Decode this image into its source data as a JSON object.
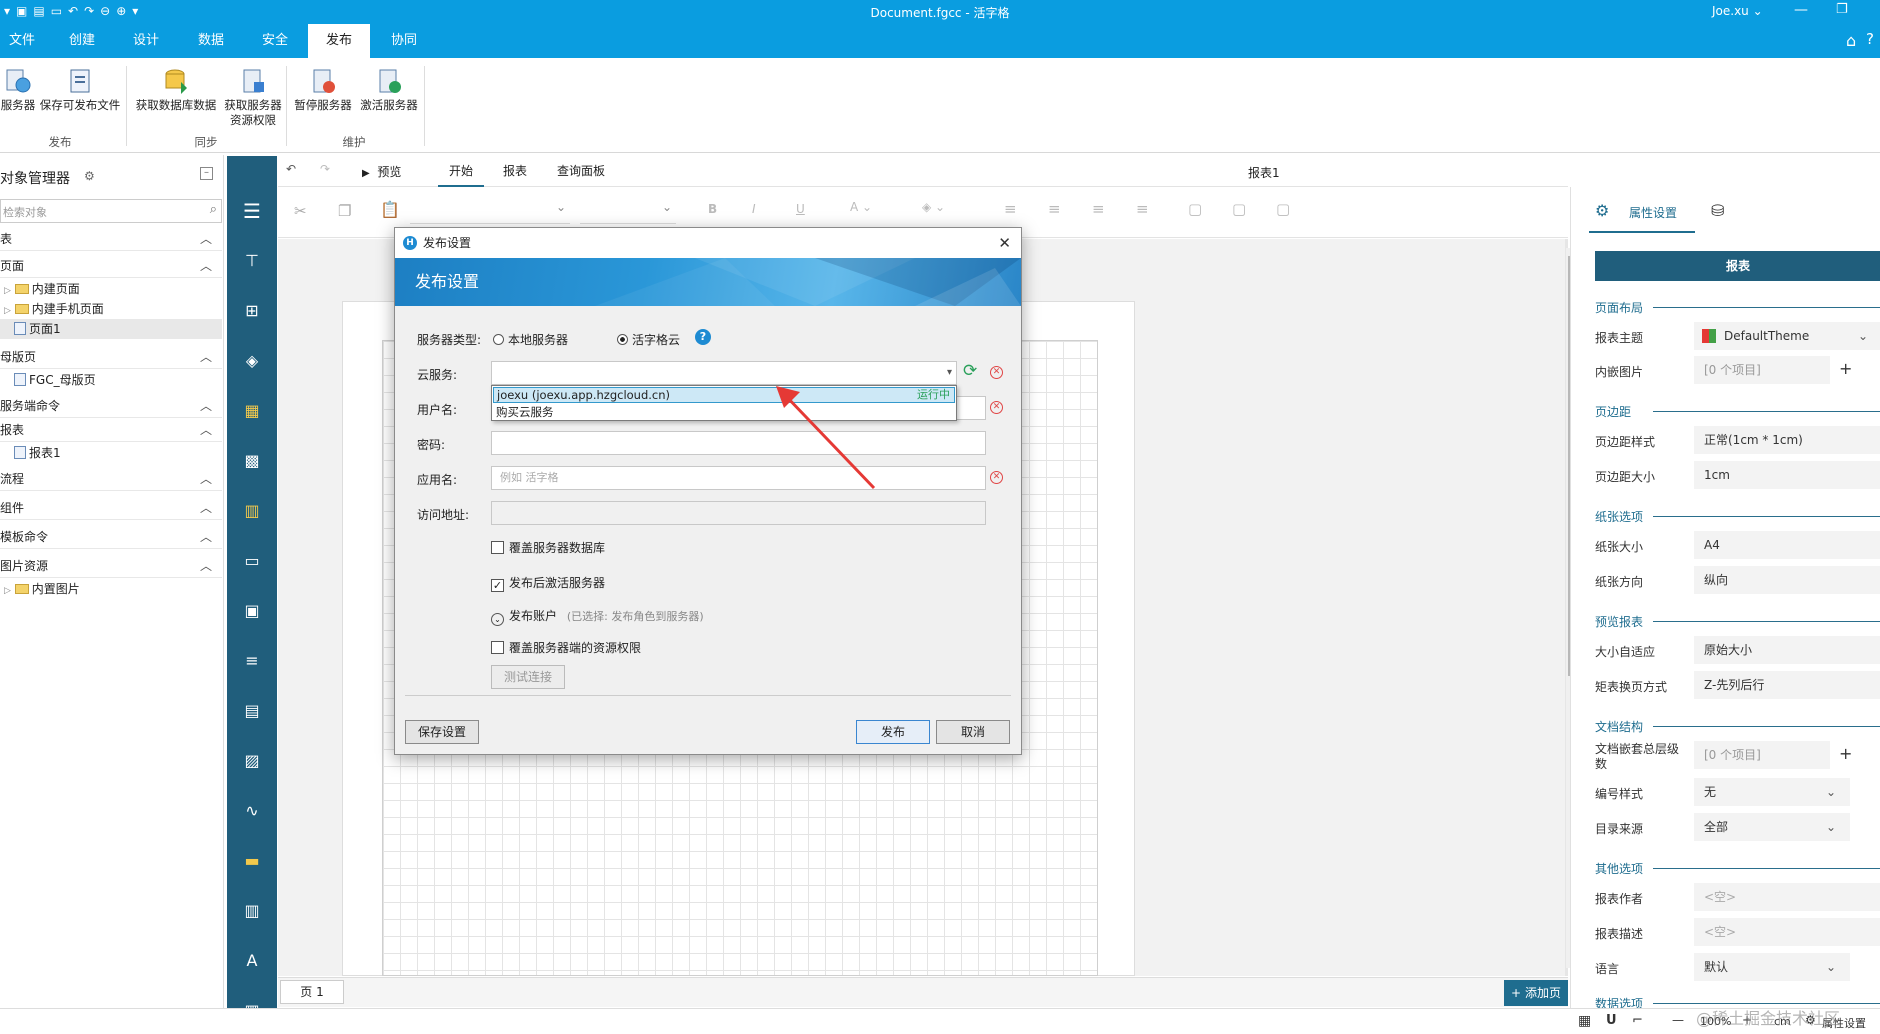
{
  "window": {
    "title": "Document.fgcc - 活字格",
    "user": "Joe.xu"
  },
  "ribbon_tabs": [
    "文件",
    "创建",
    "设计",
    "数据",
    "安全",
    "发布",
    "协同"
  ],
  "ribbon": {
    "publish_server": "服务器",
    "save_publish_file": "保存可发布文件",
    "fetch_db_data": "获取数据库数据",
    "fetch_server_perm_line1": "获取服务器",
    "fetch_server_perm_line2": "资源权限",
    "pause_server": "暂停服务器",
    "activate_server": "激活服务器",
    "group_publish": "发布",
    "group_sync": "同步",
    "group_maintain": "维护"
  },
  "left_panel": {
    "title": "对象管理器",
    "search_placeholder": "检索对象",
    "sections": {
      "table": "表",
      "page": "页面",
      "master": "母版页",
      "server_cmd": "服务端命令",
      "report": "报表",
      "flow": "流程",
      "component": "组件",
      "template_cmd": "模板命令",
      "image_res": "图片资源"
    },
    "items": {
      "builtin_page": "内建页面",
      "builtin_mobile": "内建手机页面",
      "page1": "页面1",
      "master1": "FGC_母版页",
      "report1": "报表1",
      "builtin_image": "内置图片"
    }
  },
  "doc_toolbar": {
    "preview": "预览",
    "start": "开始",
    "report": "报表",
    "query_panel": "查询面板",
    "doc_name": "报表1"
  },
  "page_tab": "页 1",
  "add_page": "添加页",
  "right_panel": {
    "tab_props": "属性设置",
    "header": "报表",
    "sec_layout": "页面布局",
    "theme_label": "报表主题",
    "theme_value": "DefaultTheme",
    "embed_label": "内嵌图片",
    "embed_value": "[0 个项目]",
    "sec_margin": "页边距",
    "margin_style_label": "页边距样式",
    "margin_style_value": "正常(1cm * 1cm)",
    "margin_size_label": "页边距大小",
    "margin_size_value": "1cm",
    "sec_paper": "纸张选项",
    "paper_size_label": "纸张大小",
    "paper_size_value": "A4",
    "paper_dir_label": "纸张方向",
    "paper_dir_value": "纵向",
    "sec_preview": "预览报表",
    "autofit_label": "大小自适应",
    "autofit_value": "原始大小",
    "matrix_label": "矩表换页方式",
    "matrix_value": "Z-先列后行",
    "sec_docstruct": "文档结构",
    "nest_label": "文档嵌套总层级数",
    "nest_value": "[0 个项目]",
    "numbering_label": "编号样式",
    "numbering_value": "无",
    "toc_label": "目录来源",
    "toc_value": "全部",
    "sec_other": "其他选项",
    "author_label": "报表作者",
    "author_value": "<空>",
    "desc_label": "报表描述",
    "desc_value": "<空>",
    "lang_label": "语言",
    "lang_value": "默认",
    "sec_data": "数据选项"
  },
  "status": {
    "zoom": "100%",
    "unit": "cm",
    "props": "属性设置"
  },
  "watermark": "@稀土掘金技术社区",
  "dialog": {
    "title": "发布设置",
    "banner": "发布设置",
    "server_type_label": "服务器类型:",
    "opt_local": "本地服务器",
    "opt_cloud": "活字格云",
    "cloud_label": "云服务:",
    "user_label": "用户名:",
    "pwd_label": "密码:",
    "app_label": "应用名:",
    "app_placeholder": "例如 活字格",
    "url_label": "访问地址:",
    "chk_overwrite_db": "覆盖服务器数据库",
    "chk_activate": "发布后激活服务器",
    "publish_account": "发布账户",
    "publish_account_note": "(已选择: 发布角色到服务器)",
    "chk_overwrite_perm": "覆盖服务器端的资源权限",
    "test_conn": "测试连接",
    "save_settings": "保存设置",
    "publish": "发布",
    "cancel": "取消",
    "dropdown_item1": "joexu (joexu.app.hzgcloud.cn)",
    "dropdown_item1_status": "运行中",
    "dropdown_item2": "购买云服务"
  },
  "colors": {
    "titlebar": "#0a9de0",
    "sidebar": "#205e7c",
    "accent": "#2a6e8c",
    "arrow": "#e53935"
  }
}
